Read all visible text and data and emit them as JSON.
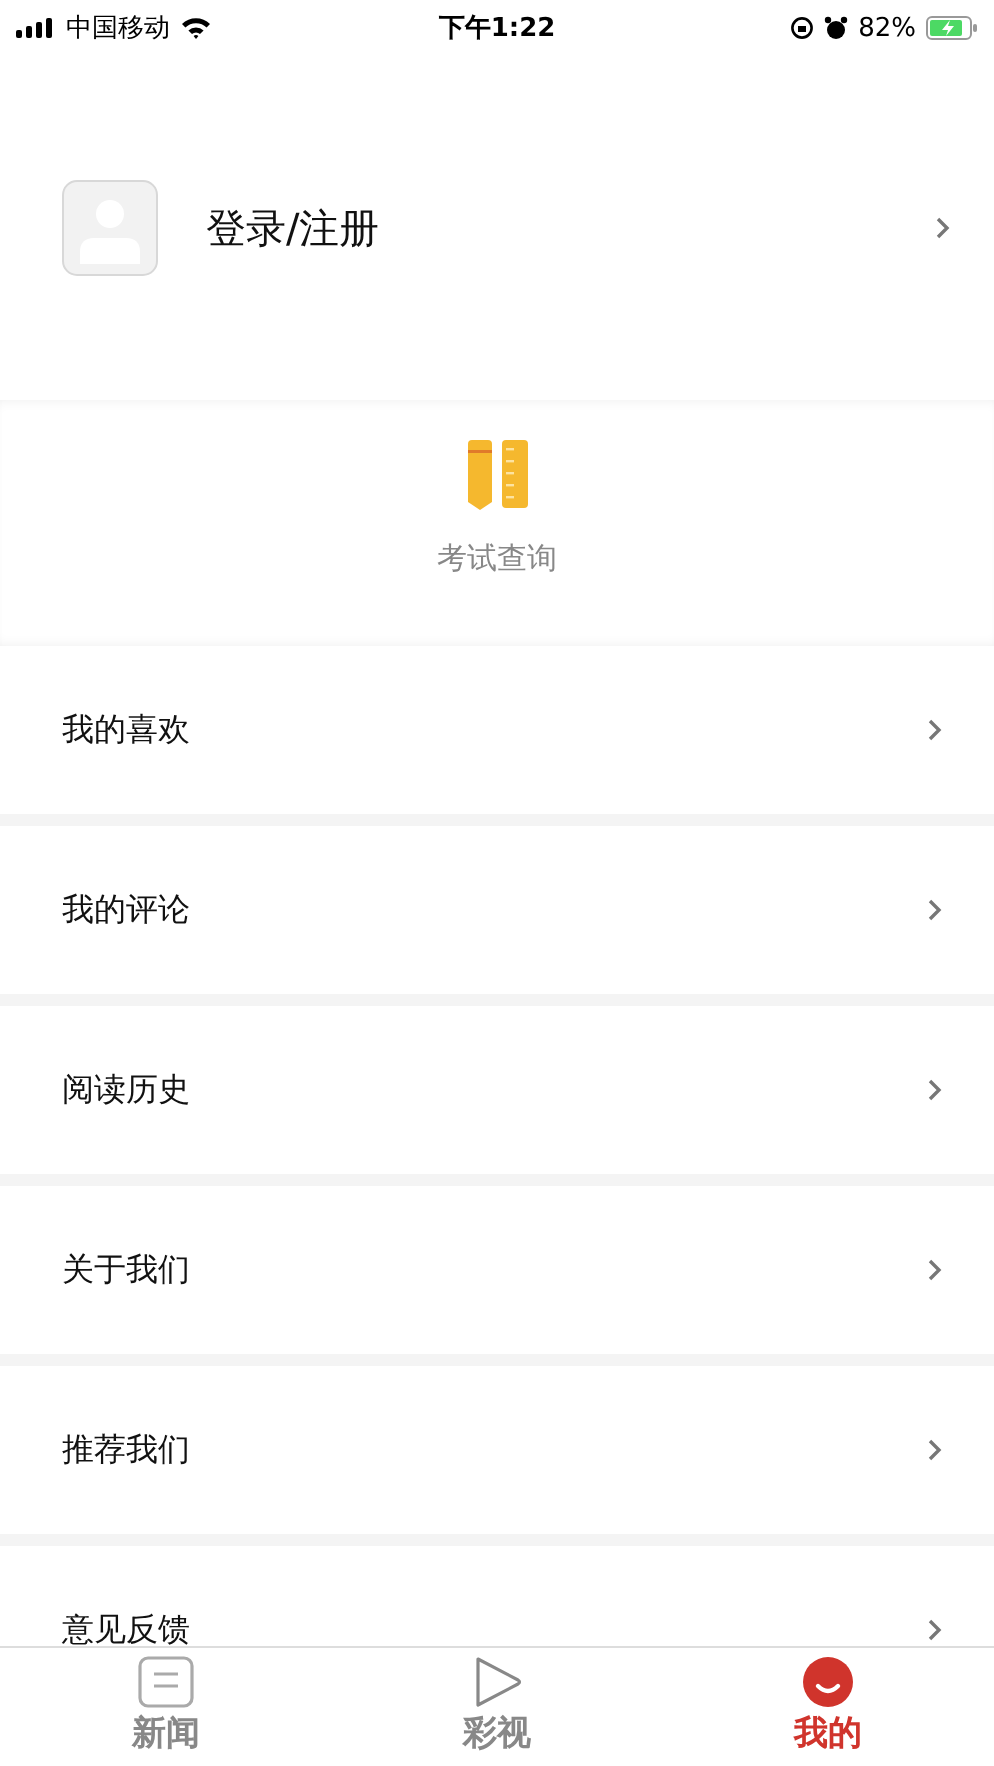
{
  "status_bar": {
    "carrier": "中国移动",
    "time": "下午1:22",
    "battery": "82%"
  },
  "profile": {
    "label": "登录/注册"
  },
  "shortcut": {
    "label": "考试查询"
  },
  "menu": [
    {
      "label": "我的喜欢"
    },
    {
      "label": "我的评论"
    },
    {
      "label": "阅读历史"
    },
    {
      "label": "关于我们"
    },
    {
      "label": "推荐我们"
    },
    {
      "label": "意见反馈"
    }
  ],
  "tabs": [
    {
      "label": "新闻",
      "kind": "news",
      "selected": false
    },
    {
      "label": "彩视",
      "kind": "video",
      "selected": false
    },
    {
      "label": "我的",
      "kind": "me",
      "selected": true
    }
  ]
}
